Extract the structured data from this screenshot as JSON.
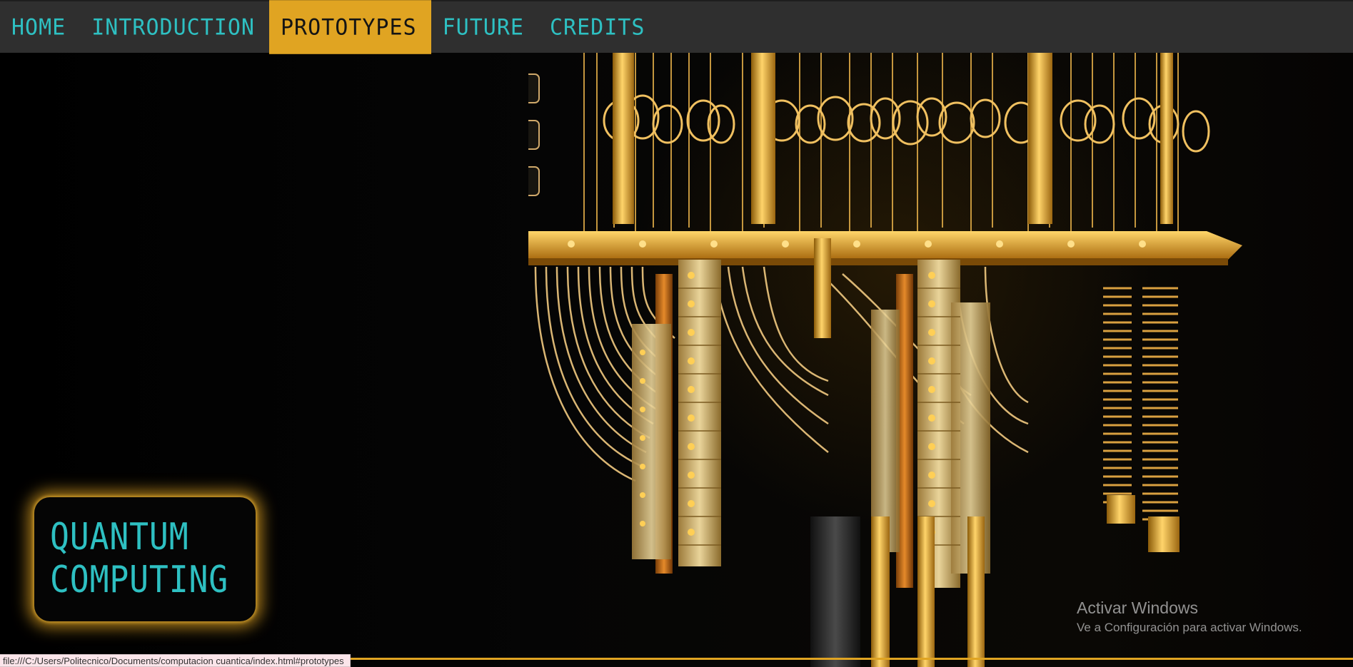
{
  "nav": {
    "items": [
      {
        "label": "HOME",
        "active": false
      },
      {
        "label": "INTRODUCTION",
        "active": false
      },
      {
        "label": "PROTOTYPES",
        "active": true
      },
      {
        "label": "FUTURE",
        "active": false
      },
      {
        "label": "CREDITS",
        "active": false
      }
    ]
  },
  "hero": {
    "title_line1": "QUANTUM",
    "title_line2": "COMPUTING",
    "image": "quantum-computer-chandelier"
  },
  "watermark": {
    "title": "Activar Windows",
    "subtitle": "Ve a Configuración para activar Windows."
  },
  "status_bar": {
    "url": "file:///C:/Users/Politecnico/Documents/computacion cuantica/index.html#prototypes"
  },
  "colors": {
    "nav_bg": "#2f2f2f",
    "nav_text": "#2ec0c2",
    "accent": "#e0a422",
    "title_text": "#2ec0c2",
    "page_bg": "#000000"
  }
}
